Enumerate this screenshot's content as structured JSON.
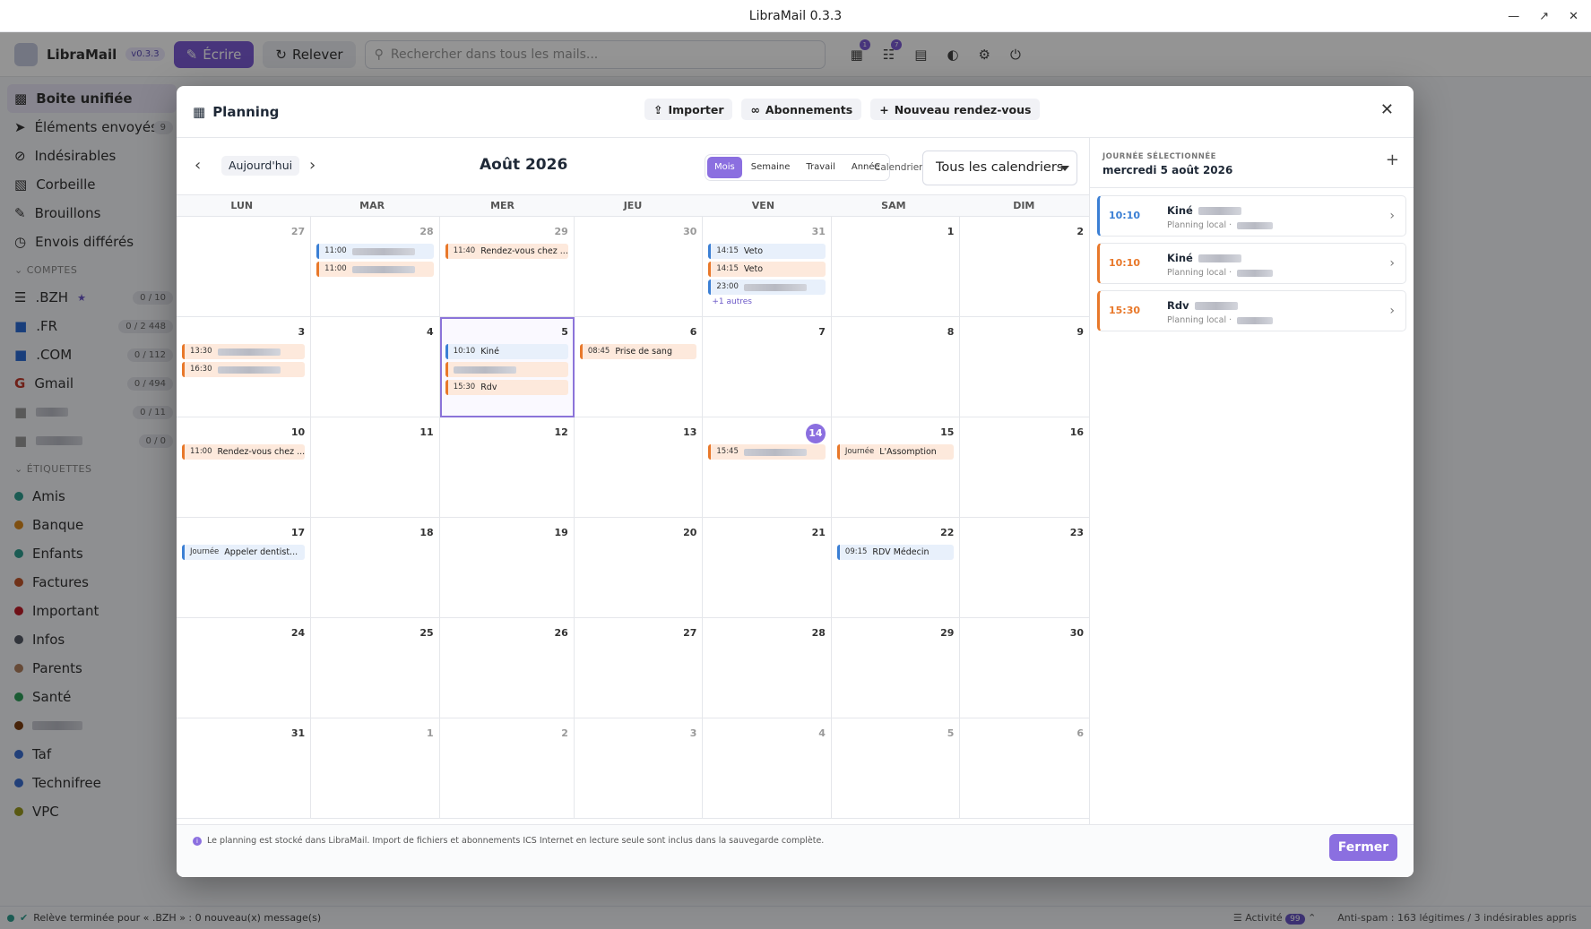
{
  "window": {
    "title": "LibraMail 0.3.3"
  },
  "topbar": {
    "app_name": "LibraMail",
    "version": "v0.3.3",
    "write_label": "Écrire",
    "fetch_label": "Relever",
    "search_placeholder": "Rechercher dans tous les mails...",
    "badge_calendar": "1",
    "badge_contacts": "7"
  },
  "sidebar": {
    "items": [
      {
        "label": "Boite unifiée",
        "count": ""
      },
      {
        "label": "Éléments envoyés",
        "count": "9"
      },
      {
        "label": "Indésirables",
        "count": ""
      },
      {
        "label": "Corbeille",
        "count": ""
      },
      {
        "label": "Brouillons",
        "count": ""
      },
      {
        "label": "Envois différés",
        "count": ""
      }
    ],
    "accounts_header": "COMPTES",
    "accounts": [
      {
        "label": ".BZH",
        "count": "0 / 10"
      },
      {
        "label": ".FR",
        "count": "0 / 2 448"
      },
      {
        "label": ".COM",
        "count": "0 / 112"
      },
      {
        "label": "Gmail",
        "count": "0 / 494"
      },
      {
        "label": "",
        "count": "0 / 11"
      },
      {
        "label": "",
        "count": "0 / 0"
      }
    ],
    "labels_header": "ÉTIQUETTES",
    "labels": [
      {
        "label": "Amis",
        "color": "#2f9e8f"
      },
      {
        "label": "Banque",
        "color": "#d9891c"
      },
      {
        "label": "Enfants",
        "color": "#2f9e8f"
      },
      {
        "label": "Factures",
        "color": "#c2562b"
      },
      {
        "label": "Important",
        "color": "#c01c28"
      },
      {
        "label": "Infos",
        "color": "#555b66"
      },
      {
        "label": "Parents",
        "color": "#b08060"
      },
      {
        "label": "Santé",
        "color": "#2e9d59"
      },
      {
        "label": "",
        "color": "#7a3d10"
      },
      {
        "label": "Taf",
        "color": "#3b6fd0"
      },
      {
        "label": "Technifree",
        "color": "#3b6fd0"
      },
      {
        "label": "VPC",
        "color": "#9a9a20"
      }
    ]
  },
  "status": {
    "text": "Relève terminée pour « .BZH » : 0 nouveau(x) message(s)",
    "activity": "Activité",
    "activity_count": "99",
    "antispam": "Anti-spam : 163 légitimes / 3 indésirables appris"
  },
  "planning": {
    "title": "Planning",
    "import": "Importer",
    "subscriptions": "Abonnements",
    "new_appointment": "Nouveau rendez-vous",
    "today": "Aujourd'hui",
    "month_title": "Août 2026",
    "views": [
      "Mois",
      "Semaine",
      "Travail",
      "Année"
    ],
    "active_view": "Mois",
    "calendar_label": "Calendrier",
    "calendar_select": "Tous les calendriers",
    "weekdays": [
      "LUN",
      "MAR",
      "MER",
      "JEU",
      "VEN",
      "SAM",
      "DIM"
    ],
    "days": [
      {
        "n": "27",
        "out": true,
        "events": []
      },
      {
        "n": "28",
        "out": true,
        "events": [
          {
            "time": "11:00",
            "title": "",
            "color": "blue"
          },
          {
            "time": "11:00",
            "title": "",
            "color": "orange"
          }
        ]
      },
      {
        "n": "29",
        "out": true,
        "events": [
          {
            "time": "11:40",
            "title": "Rendez-vous chez ...",
            "color": "orange"
          }
        ]
      },
      {
        "n": "30",
        "out": true,
        "events": []
      },
      {
        "n": "31",
        "out": true,
        "events": [
          {
            "time": "14:15",
            "title": "Veto",
            "color": "blue"
          },
          {
            "time": "14:15",
            "title": "Veto",
            "color": "orange"
          },
          {
            "time": "23:00",
            "title": "",
            "color": "blue"
          }
        ],
        "more": "+1 autres"
      },
      {
        "n": "1",
        "events": []
      },
      {
        "n": "2",
        "events": []
      },
      {
        "n": "3",
        "events": [
          {
            "time": "13:30",
            "title": "",
            "color": "orange"
          },
          {
            "time": "16:30",
            "title": "",
            "color": "orange"
          }
        ]
      },
      {
        "n": "4",
        "events": []
      },
      {
        "n": "5",
        "selected": true,
        "events": [
          {
            "time": "10:10",
            "title": "Kiné",
            "color": "blue"
          },
          {
            "time": "",
            "title": "",
            "color": "orange"
          },
          {
            "time": "15:30",
            "title": "Rdv",
            "color": "orange"
          }
        ]
      },
      {
        "n": "6",
        "events": [
          {
            "time": "08:45",
            "title": "Prise de sang",
            "color": "orange"
          }
        ]
      },
      {
        "n": "7",
        "events": []
      },
      {
        "n": "8",
        "events": []
      },
      {
        "n": "9",
        "events": []
      },
      {
        "n": "10",
        "events": [
          {
            "time": "11:00",
            "title": "Rendez-vous chez ...",
            "color": "orange"
          }
        ]
      },
      {
        "n": "11",
        "events": []
      },
      {
        "n": "12",
        "events": []
      },
      {
        "n": "13",
        "events": []
      },
      {
        "n": "14",
        "today": true,
        "events": [
          {
            "time": "15:45",
            "title": "",
            "color": "orange"
          }
        ]
      },
      {
        "n": "15",
        "events": [
          {
            "time": "Journée",
            "title": "L'Assomption",
            "color": "orange"
          }
        ]
      },
      {
        "n": "16",
        "events": []
      },
      {
        "n": "17",
        "events": [
          {
            "time": "Journée",
            "title": "Appeler dentist...",
            "color": "blue"
          }
        ]
      },
      {
        "n": "18",
        "events": []
      },
      {
        "n": "19",
        "events": []
      },
      {
        "n": "20",
        "events": []
      },
      {
        "n": "21",
        "events": []
      },
      {
        "n": "22",
        "events": [
          {
            "time": "09:15",
            "title": "RDV Médecin",
            "color": "blue"
          }
        ]
      },
      {
        "n": "23",
        "events": []
      },
      {
        "n": "24",
        "events": []
      },
      {
        "n": "25",
        "events": []
      },
      {
        "n": "26",
        "events": []
      },
      {
        "n": "27",
        "events": []
      },
      {
        "n": "28",
        "events": []
      },
      {
        "n": "29",
        "events": []
      },
      {
        "n": "30",
        "events": []
      },
      {
        "n": "31",
        "events": []
      },
      {
        "n": "1",
        "out": true,
        "events": []
      },
      {
        "n": "2",
        "out": true,
        "events": []
      },
      {
        "n": "3",
        "out": true,
        "events": []
      },
      {
        "n": "4",
        "out": true,
        "events": []
      },
      {
        "n": "5",
        "out": true,
        "events": []
      },
      {
        "n": "6",
        "out": true,
        "events": []
      }
    ],
    "side": {
      "caption": "JOURNÉE SÉLECTIONNÉE",
      "date": "mercredi 5 août 2026",
      "events": [
        {
          "time": "10:10",
          "title": "Kiné",
          "sub": "Planning local ·",
          "color": "blue"
        },
        {
          "time": "10:10",
          "title": "Kiné",
          "sub": "Planning local ·",
          "color": "orange"
        },
        {
          "time": "15:30",
          "title": "Rdv",
          "sub": "Planning local ·",
          "color": "orange"
        }
      ]
    },
    "footer_note": "Le planning est stocké dans LibraMail. Import de fichiers et abonnements ICS Internet en lecture seule sont inclus dans la sauvegarde complète.",
    "close_label": "Fermer"
  }
}
